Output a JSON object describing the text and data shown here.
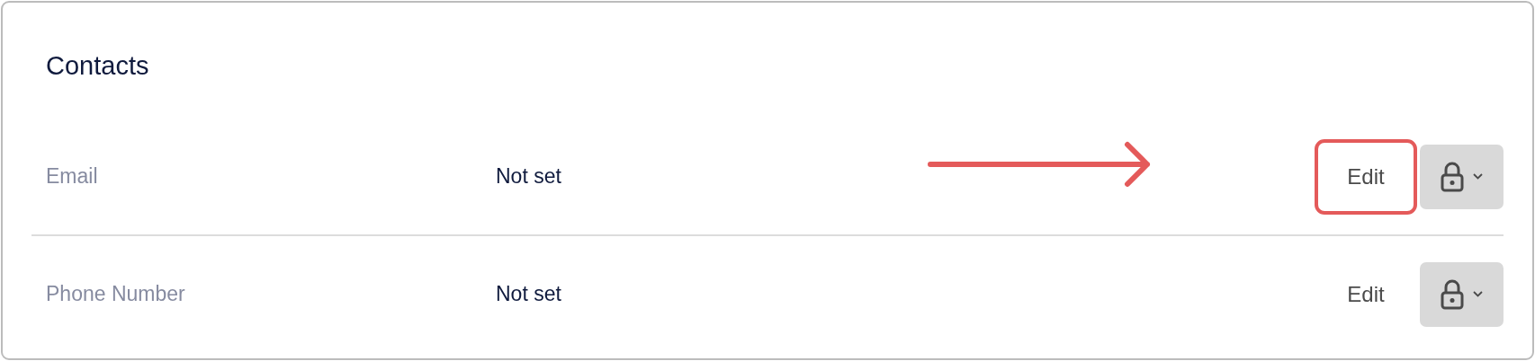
{
  "section": {
    "title": "Contacts"
  },
  "rows": [
    {
      "label": "Email",
      "value": "Not set",
      "edit": "Edit",
      "highlighted": true
    },
    {
      "label": "Phone Number",
      "value": "Not set",
      "edit": "Edit",
      "highlighted": false
    }
  ]
}
